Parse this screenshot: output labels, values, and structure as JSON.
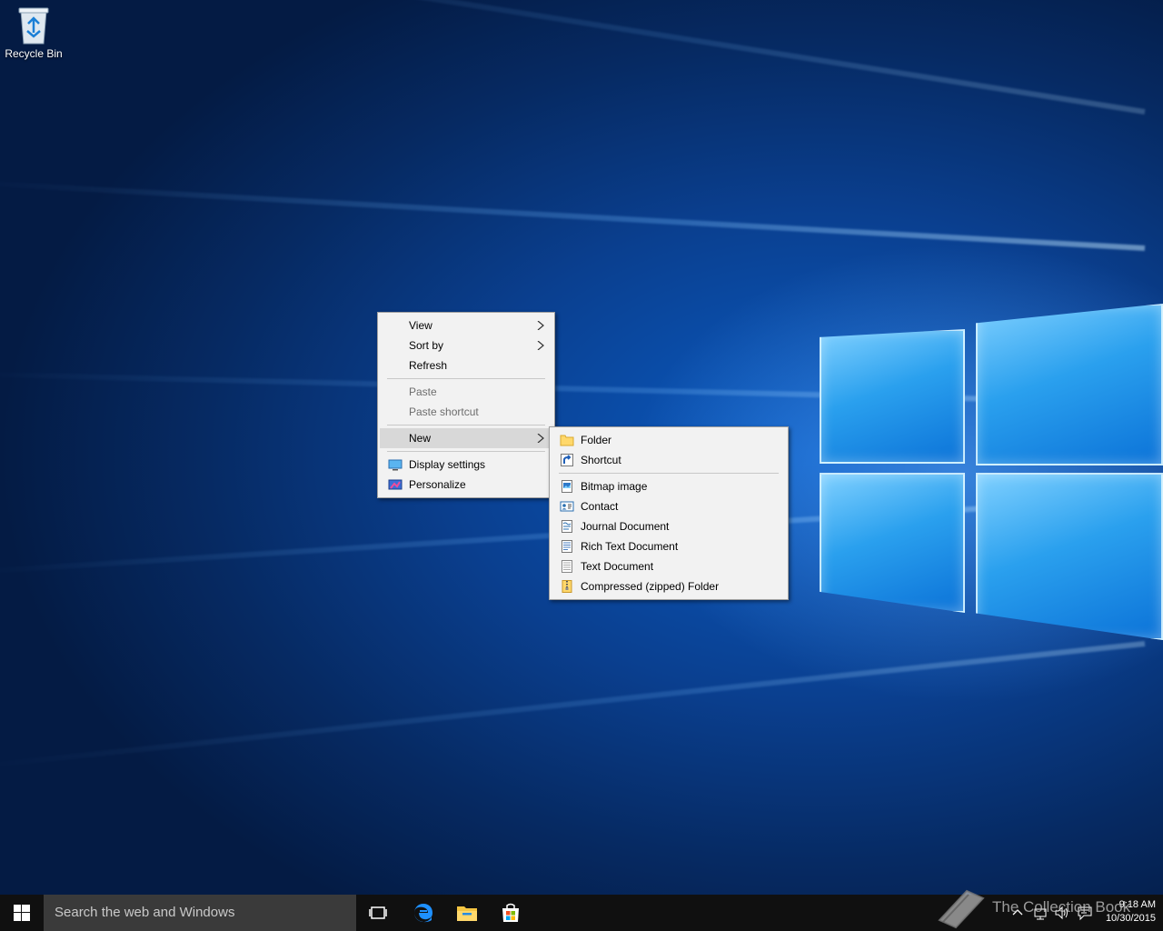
{
  "desktop": {
    "icons": [
      {
        "label": "Recycle Bin",
        "icon": "recycle-bin-icon"
      }
    ]
  },
  "context_menu": {
    "items": [
      {
        "label": "View",
        "submenu": true,
        "enabled": true
      },
      {
        "label": "Sort by",
        "submenu": true,
        "enabled": true
      },
      {
        "label": "Refresh",
        "submenu": false,
        "enabled": true
      },
      {
        "label": "Paste",
        "submenu": false,
        "enabled": false
      },
      {
        "label": "Paste shortcut",
        "submenu": false,
        "enabled": false
      },
      {
        "label": "New",
        "submenu": true,
        "enabled": true,
        "highlighted": true
      },
      {
        "label": "Display settings",
        "submenu": false,
        "enabled": true,
        "icon": "display-settings-icon"
      },
      {
        "label": "Personalize",
        "submenu": false,
        "enabled": true,
        "icon": "personalize-icon"
      }
    ]
  },
  "new_submenu": {
    "items": [
      {
        "label": "Folder",
        "icon": "folder-icon"
      },
      {
        "label": "Shortcut",
        "icon": "shortcut-icon"
      },
      {
        "label": "Bitmap image",
        "icon": "bitmap-image-icon"
      },
      {
        "label": "Contact",
        "icon": "contact-icon"
      },
      {
        "label": "Journal Document",
        "icon": "journal-document-icon"
      },
      {
        "label": "Rich Text Document",
        "icon": "rich-text-document-icon"
      },
      {
        "label": "Text Document",
        "icon": "text-document-icon"
      },
      {
        "label": "Compressed (zipped) Folder",
        "icon": "zipped-folder-icon"
      }
    ]
  },
  "taskbar": {
    "search_placeholder": "Search the web and Windows",
    "pinned": [
      "task-view-icon",
      "edge-icon",
      "file-explorer-icon",
      "store-icon"
    ],
    "clock": {
      "time": "9:18 AM",
      "date": "10/30/2015"
    },
    "watermark": "The Collection Book"
  },
  "colors": {
    "menu_bg": "#f2f2f2",
    "menu_highlight": "#d8d8d8",
    "taskbar_bg": "#101010",
    "search_bg": "#3a3a3a",
    "desktop_blue": "#0a3f8f"
  }
}
